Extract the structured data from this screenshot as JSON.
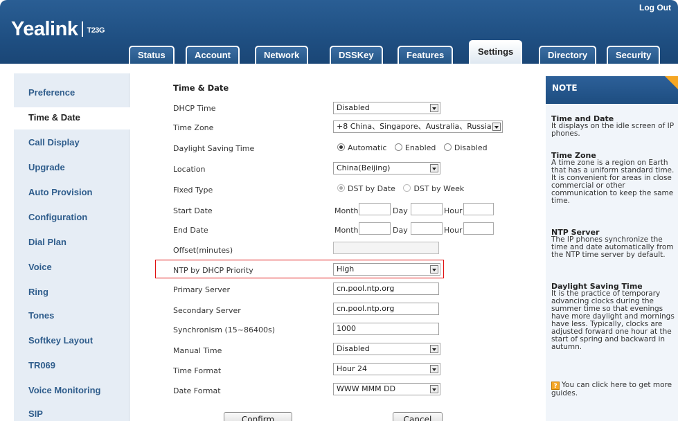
{
  "header": {
    "brand": "Yealink",
    "model": "T23G",
    "logout": "Log Out"
  },
  "tabs": [
    "Status",
    "Account",
    "Network",
    "DSSKey",
    "Features",
    "Settings",
    "Directory",
    "Security"
  ],
  "active_tab": "Settings",
  "sidebar": {
    "items": [
      "Preference",
      "Time & Date",
      "Call Display",
      "Upgrade",
      "Auto Provision",
      "Configuration",
      "Dial Plan",
      "Voice",
      "Ring",
      "Tones",
      "Softkey Layout",
      "TR069",
      "Voice Monitoring",
      "SIP"
    ],
    "active": "Time & Date"
  },
  "form": {
    "section_title": "Time & Date",
    "labels": {
      "dhcp_time": "DHCP Time",
      "time_zone": "Time Zone",
      "dst": "Daylight Saving Time",
      "location": "Location",
      "fixed_type": "Fixed Type",
      "start_date": "Start Date",
      "end_date": "End Date",
      "offset": "Offset(minutes)",
      "ntp_priority": "NTP by DHCP Priority",
      "primary_server": "Primary Server",
      "secondary_server": "Secondary Server",
      "synchronism": "Synchronism (15~86400s)",
      "manual_time": "Manual Time",
      "time_format": "Time Format",
      "date_format": "Date Format"
    },
    "values": {
      "dhcp_time": "Disabled",
      "time_zone": "+8 China、Singapore、Australia、Russia",
      "location": "China(Beijing)",
      "offset": "",
      "ntp_priority": "High",
      "primary_server": "cn.pool.ntp.org",
      "secondary_server": "cn.pool.ntp.org",
      "synchronism": "1000",
      "manual_time": "Disabled",
      "time_format": "Hour 24",
      "date_format": "WWW MMM DD"
    },
    "dst_options": [
      "Automatic",
      "Enabled",
      "Disabled"
    ],
    "dst_selected": "Automatic",
    "fixed_type_options": [
      "DST by Date",
      "DST by Week"
    ],
    "fixed_type_selected": "DST by Date",
    "date_parts": [
      "Month",
      "Day",
      "Hour"
    ],
    "confirm": "Confirm",
    "cancel": "Cancel"
  },
  "note": {
    "title": "NOTE",
    "sections": [
      {
        "heading": "Time and Date",
        "text": "It displays on the idle screen of IP phones."
      },
      {
        "heading": "Time Zone",
        "text": "A time zone is a region on Earth that has a uniform standard time. It is convenient for areas in close commercial or other communication to keep the same time."
      },
      {
        "heading": "NTP Server",
        "text": "The IP phones synchronize the time and date automatically from the NTP time server by default."
      },
      {
        "heading": "Daylight Saving Time",
        "text": "It is the practice of temporary advancing clocks during the summer time so that evenings have more daylight and mornings have less. Typically, clocks are adjusted forward one hour at the start of spring and backward in autumn."
      }
    ],
    "guide": "You can click here to get more guides."
  }
}
